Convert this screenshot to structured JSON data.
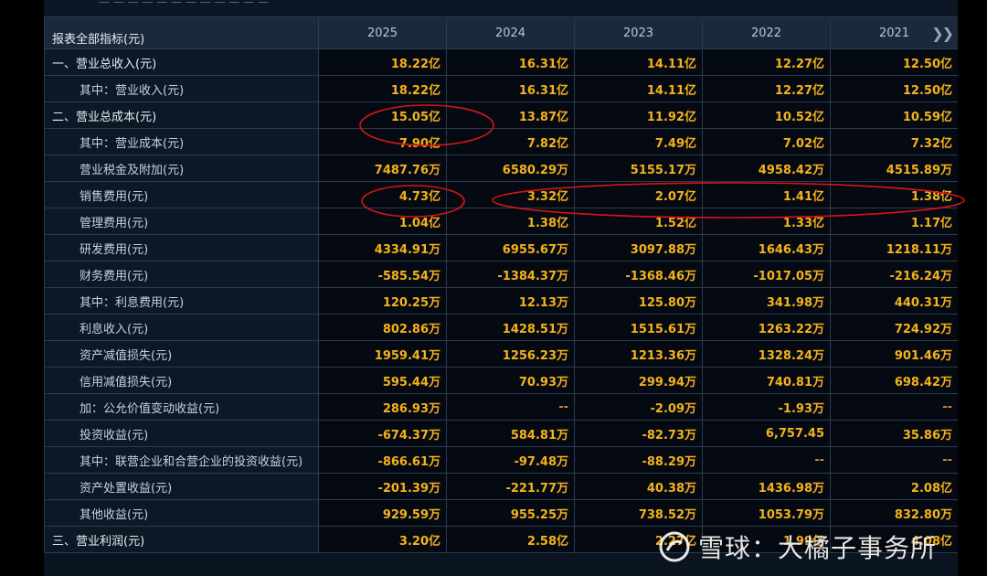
{
  "header": {
    "corner_label": "报表全部指标(元)",
    "years": [
      "2025",
      "2024",
      "2023",
      "2022",
      "2021"
    ],
    "next_icon": "double-chevron-right-icon",
    "top_strip_text": "一 一 一 一 一 一 一 一 一 一 一 一"
  },
  "rows": [
    {
      "label": "一、营业总收入(元)",
      "level": "top",
      "values": [
        "18.22亿",
        "16.31亿",
        "14.11亿",
        "12.27亿",
        "12.50亿"
      ]
    },
    {
      "label": "其中：营业收入(元)",
      "level": "sub",
      "values": [
        "18.22亿",
        "16.31亿",
        "14.11亿",
        "12.27亿",
        "12.50亿"
      ]
    },
    {
      "label": "二、营业总成本(元)",
      "level": "top",
      "values": [
        "15.05亿",
        "13.87亿",
        "11.92亿",
        "10.52亿",
        "10.59亿"
      ]
    },
    {
      "label": "其中：营业成本(元)",
      "level": "sub",
      "values": [
        "7.90亿",
        "7.82亿",
        "7.49亿",
        "7.02亿",
        "7.32亿"
      ]
    },
    {
      "label": "营业税金及附加(元)",
      "level": "sub",
      "values": [
        "7487.76万",
        "6580.29万",
        "5155.17万",
        "4958.42万",
        "4515.89万"
      ]
    },
    {
      "label": "销售费用(元)",
      "level": "sub",
      "values": [
        "4.73亿",
        "3.32亿",
        "2.07亿",
        "1.41亿",
        "1.38亿"
      ]
    },
    {
      "label": "管理费用(元)",
      "level": "sub",
      "values": [
        "1.04亿",
        "1.38亿",
        "1.52亿",
        "1.33亿",
        "1.17亿"
      ]
    },
    {
      "label": "研发费用(元)",
      "level": "sub",
      "values": [
        "4334.91万",
        "6955.67万",
        "3097.88万",
        "1646.43万",
        "1218.11万"
      ]
    },
    {
      "label": "财务费用(元)",
      "level": "sub",
      "values": [
        "-585.54万",
        "-1384.37万",
        "-1368.46万",
        "-1017.05万",
        "-216.24万"
      ]
    },
    {
      "label": "其中：利息费用(元)",
      "level": "sub",
      "values": [
        "120.25万",
        "12.13万",
        "125.80万",
        "341.98万",
        "440.31万"
      ]
    },
    {
      "label": "利息收入(元)",
      "level": "sub",
      "values": [
        "802.86万",
        "1428.51万",
        "1515.61万",
        "1263.22万",
        "724.92万"
      ]
    },
    {
      "label": "资产减值损失(元)",
      "level": "sub",
      "values": [
        "1959.41万",
        "1256.23万",
        "1213.36万",
        "1328.24万",
        "901.46万"
      ]
    },
    {
      "label": "信用减值损失(元)",
      "level": "sub",
      "values": [
        "595.44万",
        "70.93万",
        "299.94万",
        "740.81万",
        "698.42万"
      ]
    },
    {
      "label": "加：公允价值变动收益(元)",
      "level": "sub",
      "values": [
        "286.93万",
        "--",
        "-2.09万",
        "-1.93万",
        "--"
      ]
    },
    {
      "label": "投资收益(元)",
      "level": "sub",
      "values": [
        "-674.37万",
        "584.81万",
        "-82.73万",
        "6,757.45",
        "35.86万"
      ]
    },
    {
      "label": "其中：联营企业和合营企业的投资收益(元)",
      "level": "sub",
      "values": [
        "-866.61万",
        "-97.48万",
        "-88.29万",
        "--",
        "--"
      ]
    },
    {
      "label": "资产处置收益(元)",
      "level": "sub",
      "values": [
        "-201.39万",
        "-221.77万",
        "40.38万",
        "1436.98万",
        "2.08亿"
      ]
    },
    {
      "label": "其他收益(元)",
      "level": "sub",
      "values": [
        "929.59万",
        "955.25万",
        "738.52万",
        "1053.79万",
        "832.80万"
      ]
    },
    {
      "label": "三、营业利润(元)",
      "level": "top",
      "values": [
        "3.20亿",
        "2.58亿",
        "2.27亿",
        "1.99亿",
        "4.08亿"
      ]
    }
  ],
  "annotations": {
    "color": "#d81414"
  },
  "watermark": {
    "icon": "snowball-logo-icon",
    "text": "雪球：大橘子事务所"
  },
  "colors": {
    "value": "#f5b21a",
    "label": "#c8d1db",
    "header_bg": "#1a2a3c",
    "grid": "#2a3b4f"
  }
}
